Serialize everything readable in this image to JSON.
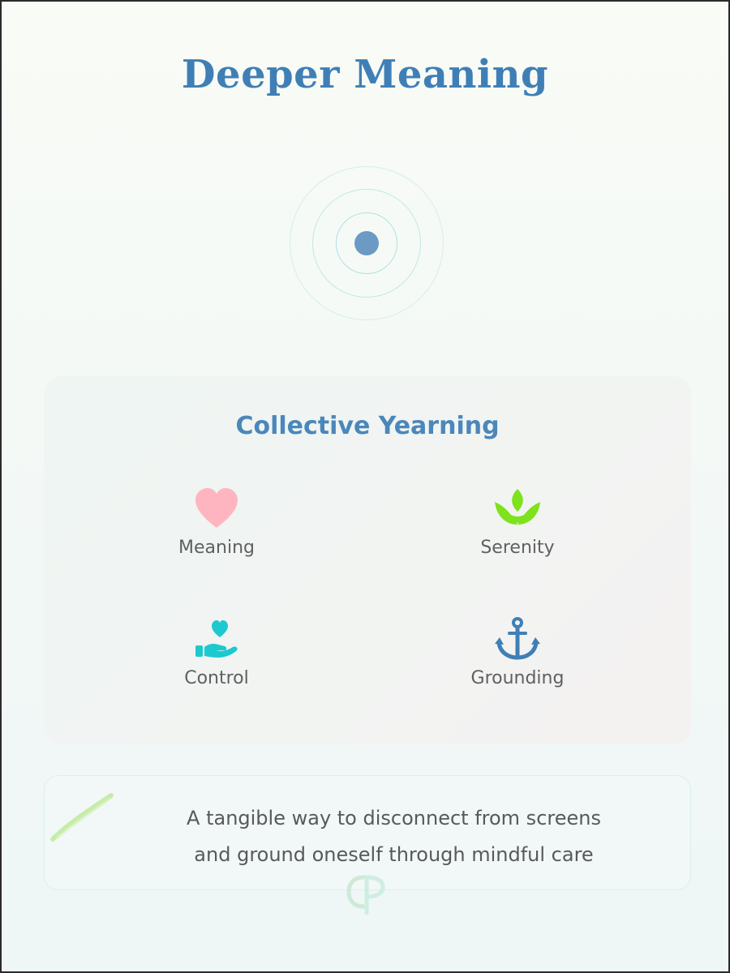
{
  "page": {
    "title": "Deeper Meaning"
  },
  "yearning": {
    "title": "Collective Yearning",
    "items": [
      {
        "label": "Meaning",
        "icon": "heart-icon",
        "color": "#ffb5c0"
      },
      {
        "label": "Serenity",
        "icon": "lotus-icon",
        "color": "#7ee21c"
      },
      {
        "label": "Control",
        "icon": "hand-holding-heart-icon",
        "color": "#1cc9cf"
      },
      {
        "label": "Grounding",
        "icon": "anchor-icon",
        "color": "#3f7fb6"
      }
    ]
  },
  "tagline": {
    "line1": "A tangible way to disconnect from screens",
    "line2": "and ground oneself through mindful care"
  },
  "colors": {
    "title": "#3f7fb6",
    "accent_dot": "#6b9ac4",
    "ring": "#c9ecec"
  }
}
